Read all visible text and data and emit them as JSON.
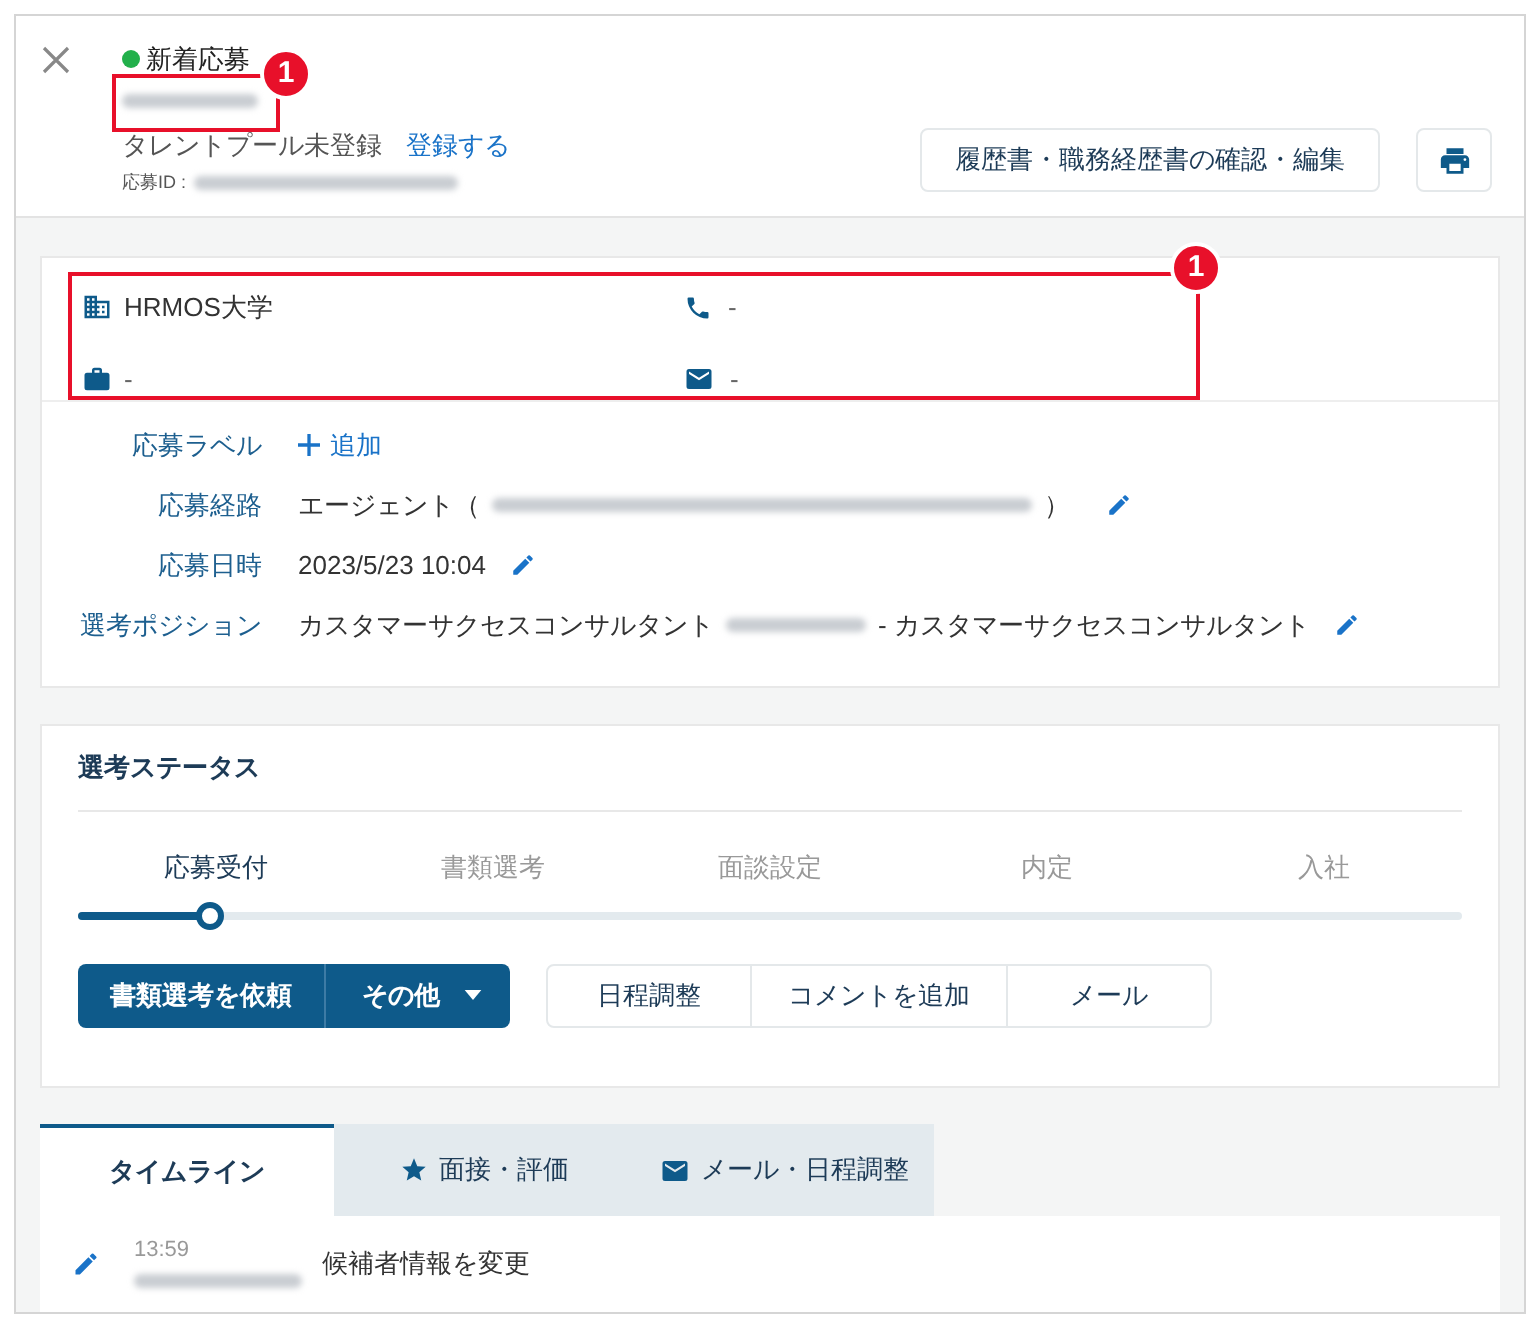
{
  "header": {
    "status": {
      "label": "新着応募",
      "color": "#22b04b"
    },
    "talent_pool": "タレントプール未登録",
    "register_link": "登録する",
    "application_id_label": "応募ID :",
    "resume_button": "履歴書・職務経歴書の確認・編集"
  },
  "contact": {
    "school": "HRMOS大学",
    "phone": "-",
    "job": "-",
    "email": "-"
  },
  "details": [
    {
      "label": "応募ラベル",
      "kind": "add",
      "value": "追加"
    },
    {
      "label": "応募経路",
      "kind": "route",
      "value": "エージェント（",
      "suffix": "）"
    },
    {
      "label": "応募日時",
      "kind": "text",
      "value": "2023/5/23 10:04"
    },
    {
      "label": "選考ポジション",
      "kind": "position",
      "value": "カスタマーサクセスコンサルタント",
      "suffix": "- カスタマーサクセスコンサルタント"
    }
  ],
  "selection_status": {
    "title": "選考ステータス",
    "level": 0.096,
    "steps": [
      {
        "label": "応募受付",
        "selected": true
      },
      {
        "label": "書類選考",
        "selected": false
      },
      {
        "label": "面談設定",
        "selected": false
      },
      {
        "label": "内定",
        "selected": false
      },
      {
        "label": "入社",
        "selected": false
      }
    ],
    "primary_button": "書類選考を依頼",
    "more_button": "その他",
    "actions": [
      "日程調整",
      "コメントを追加",
      "メール"
    ]
  },
  "tabs": [
    {
      "label": "タイムライン",
      "selected": true,
      "kind": "plain"
    },
    {
      "label": "面接・評価",
      "selected": false,
      "kind": "star"
    },
    {
      "label": "メール・日程調整",
      "selected": false,
      "kind": "mail"
    }
  ],
  "timeline": [
    {
      "time": "13:59",
      "text": "候補者情報を変更"
    }
  ],
  "annotations": [
    {
      "label": "1"
    },
    {
      "label": "1"
    }
  ]
}
